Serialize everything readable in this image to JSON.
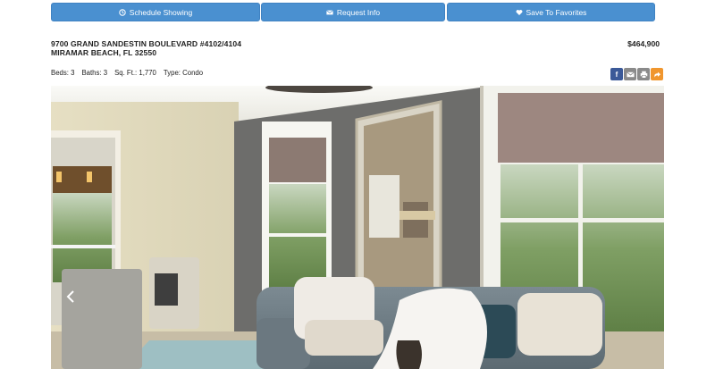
{
  "actions": {
    "schedule_label": "Schedule Showing",
    "request_label": "Request Info",
    "favorite_label": "Save To Favorites"
  },
  "listing": {
    "address_line1": "9700 GRAND SANDESTIN BOULEVARD #4102/4104",
    "address_line2": "MIRAMAR BEACH, FL 32550",
    "price": "$464,900",
    "beds": "Beds: 3",
    "baths": "Baths: 3",
    "sqft": "Sq. Ft.: 1,770",
    "type": "Type: Condo"
  },
  "share": {
    "facebook": "f",
    "colors": {
      "facebook": "#3b5998",
      "email": "#8a8a8a",
      "print": "#8a8a8a",
      "share": "#f0962e"
    }
  },
  "icons": [
    "clock-icon",
    "envelope-icon",
    "heart-icon",
    "facebook-icon",
    "email-icon",
    "print-icon",
    "share-icon",
    "chevron-left-icon"
  ],
  "accent": "#4a90d0"
}
